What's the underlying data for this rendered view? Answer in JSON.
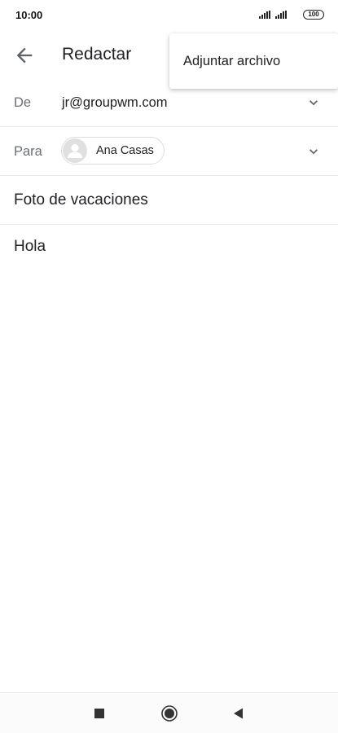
{
  "status_bar": {
    "time": "10:00",
    "battery": "100",
    "icons": [
      "signal-icon",
      "signal-icon",
      "battery-icon"
    ]
  },
  "app_bar": {
    "title": "Redactar",
    "back_icon": "arrow-left-icon"
  },
  "overflow_menu": {
    "items": [
      {
        "label": "Adjuntar archivo"
      }
    ]
  },
  "compose": {
    "from": {
      "label": "De",
      "value": "jr@groupwm.com"
    },
    "to": {
      "label": "Para",
      "recipients": [
        {
          "name": "Ana Casas",
          "icon": "person-avatar-icon"
        }
      ]
    },
    "subject": "Foto de vacaciones",
    "body": "Hola"
  },
  "nav_bar": {
    "buttons": [
      "recents-square-icon",
      "home-circle-icon",
      "back-triangle-icon"
    ]
  },
  "colors": {
    "text_primary": "#202124",
    "text_secondary": "#6b6f73",
    "divider": "#e8eaed",
    "chip_border": "#dadce0"
  }
}
